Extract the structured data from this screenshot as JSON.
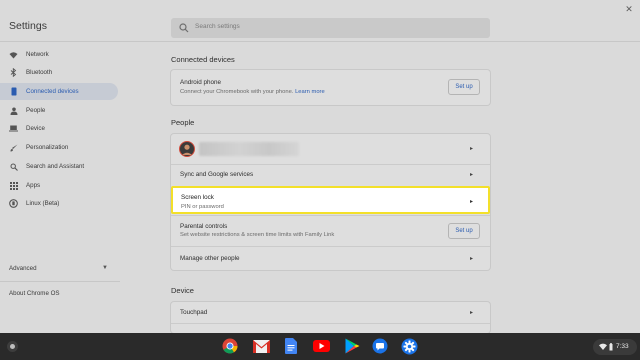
{
  "header": {
    "title": "Settings",
    "search_placeholder": "Search settings",
    "close_icon": "close-icon"
  },
  "sidebar": {
    "items": [
      {
        "label": "Network",
        "icon": "wifi-icon"
      },
      {
        "label": "Bluetooth",
        "icon": "bluetooth-icon"
      },
      {
        "label": "Connected devices",
        "icon": "phone-icon",
        "active": true
      },
      {
        "label": "People",
        "icon": "person-icon"
      },
      {
        "label": "Device",
        "icon": "laptop-icon"
      },
      {
        "label": "Personalization",
        "icon": "brush-icon"
      },
      {
        "label": "Search and Assistant",
        "icon": "search-icon"
      },
      {
        "label": "Apps",
        "icon": "apps-grid-icon"
      },
      {
        "label": "Linux (Beta)",
        "icon": "linux-icon"
      }
    ],
    "advanced_label": "Advanced",
    "about_label": "About Chrome OS"
  },
  "main": {
    "connected_devices": {
      "title": "Connected devices",
      "android_phone": {
        "title": "Android phone",
        "subtitle": "Connect your Chromebook with your phone.",
        "link": "Learn more",
        "button": "Set up"
      }
    },
    "people": {
      "title": "People",
      "sync_label": "Sync and Google services",
      "screen_lock": {
        "title": "Screen lock",
        "subtitle": "PIN or password"
      },
      "parental_controls": {
        "title": "Parental controls",
        "subtitle": "Set website restrictions & screen time limits with Family Link",
        "button": "Set up"
      },
      "manage_other": "Manage other people"
    },
    "device": {
      "title": "Device",
      "touchpad_label": "Touchpad"
    }
  },
  "shelf": {
    "apps": [
      "chrome-icon",
      "gmail-icon",
      "docs-icon",
      "youtube-icon",
      "play-store-icon",
      "messages-icon",
      "settings-icon"
    ],
    "time": "7:33"
  },
  "colors": {
    "accent": "#2b5cb0",
    "highlight_border": "#f3e02a",
    "shelf": "#2a2a2a"
  }
}
